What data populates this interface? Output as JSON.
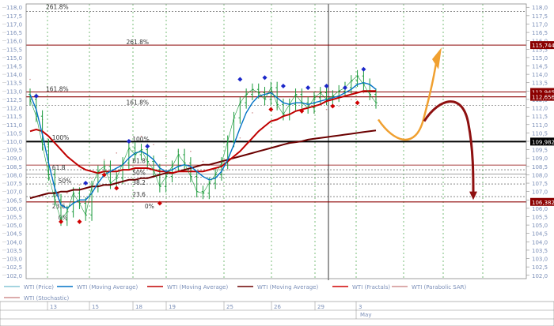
{
  "colors": {
    "price": "#1a9a3a",
    "ma_fast": "#0072c6",
    "ma_mid": "#c00000",
    "ma_slow": "#6b0000",
    "fractal_up": "#1b27c9",
    "fractal_down": "#d00000",
    "sar": "#d09090",
    "level_dark_red": "#8b0000",
    "arrow_orange": "#f0a030",
    "arrow_darkred": "#8e1010",
    "axis_text": "#7b8fb8",
    "grid_dotted": "#40a040"
  },
  "chart_data": {
    "type": "line",
    "title": "",
    "ylim": [
      101.8,
      118.2
    ],
    "y_ticks": [
      102.0,
      102.5,
      103.0,
      103.5,
      104.0,
      104.5,
      105.0,
      105.5,
      106.0,
      106.5,
      107.0,
      107.5,
      108.0,
      108.5,
      109.0,
      109.5,
      110.0,
      110.5,
      111.0,
      111.5,
      112.0,
      112.5,
      113.0,
      113.5,
      114.0,
      114.5,
      115.0,
      115.5,
      116.0,
      116.5,
      117.0,
      117.5,
      118.0
    ],
    "y_tick_labels": [
      "102,0",
      "102,5",
      "103,0",
      "103,5",
      "104,0",
      "104,5",
      "105,0",
      "105,5",
      "106,0",
      "106,5",
      "107,0",
      "107,5",
      "108,0",
      "108,5",
      "109,0",
      "109,5",
      "110,0",
      "110,5",
      "111,0",
      "111,5",
      "112,0",
      "112,5",
      "113,0",
      "113,5",
      "114,0",
      "114,5",
      "115,0",
      "115,5",
      "116,0",
      "116,5",
      "117,0",
      "117,5",
      "118,0"
    ],
    "x_labels": [
      "13",
      "15",
      "18",
      "19",
      "25",
      "26",
      "29",
      "3"
    ],
    "x_sub_label": "May",
    "price_close": [
      112.5,
      111.5,
      109.8,
      108.0,
      106.5,
      105.3,
      105.8,
      106.9,
      106.3,
      105.6,
      107.3,
      108.2,
      108.5,
      107.5,
      107.8,
      108.7,
      109.6,
      109.2,
      109.5,
      108.8,
      108.3,
      107.3,
      107.9,
      108.5,
      109.2,
      108.7,
      107.9,
      107.0,
      106.9,
      107.5,
      108.0,
      108.7,
      110.0,
      111.4,
      112.3,
      112.8,
      113.1,
      112.9,
      112.5,
      113.2,
      112.2,
      111.6,
      112.2,
      112.8,
      112.3,
      112.0,
      112.6,
      112.9,
      112.5,
      112.7,
      113.0,
      113.2,
      113.6,
      113.9,
      113.4,
      112.8,
      112.3
    ],
    "fractals_up": [
      {
        "x": 1,
        "y": 112.7
      },
      {
        "x": 9,
        "y": 107.5
      },
      {
        "x": 16,
        "y": 110.0
      },
      {
        "x": 19,
        "y": 109.7
      },
      {
        "x": 34,
        "y": 113.7
      },
      {
        "x": 38,
        "y": 113.8
      },
      {
        "x": 41,
        "y": 113.3
      },
      {
        "x": 45,
        "y": 113.2
      },
      {
        "x": 48,
        "y": 113.3
      },
      {
        "x": 51,
        "y": 113.2
      },
      {
        "x": 54,
        "y": 114.3
      }
    ],
    "fractals_down": [
      {
        "x": 5,
        "y": 105.2
      },
      {
        "x": 8,
        "y": 105.2
      },
      {
        "x": 12,
        "y": 108.0
      },
      {
        "x": 14,
        "y": 107.2
      },
      {
        "x": 21,
        "y": 106.3
      },
      {
        "x": 39,
        "y": 111.9
      },
      {
        "x": 44,
        "y": 111.8
      },
      {
        "x": 49,
        "y": 112.1
      },
      {
        "x": 53,
        "y": 112.3
      }
    ],
    "ma_fast": [
      112.8,
      111.9,
      110.4,
      108.7,
      107.2,
      106.2,
      106.0,
      106.3,
      106.5,
      106.5,
      106.9,
      107.5,
      108.0,
      108.2,
      108.4,
      108.6,
      109.0,
      109.3,
      109.4,
      109.2,
      108.9,
      108.4,
      108.2,
      108.3,
      108.5,
      108.6,
      108.5,
      108.2,
      107.9,
      107.7,
      107.8,
      108.2,
      108.9,
      109.8,
      110.8,
      111.7,
      112.3,
      112.7,
      112.8,
      112.9,
      112.6,
      112.3,
      112.2,
      112.3,
      112.3,
      112.2,
      112.3,
      112.4,
      112.5,
      112.6,
      112.7,
      112.9,
      113.1,
      113.4,
      113.5,
      113.4,
      113.1
    ],
    "ma_mid": [
      110.6,
      110.7,
      110.6,
      110.3,
      109.9,
      109.5,
      109.1,
      108.8,
      108.5,
      108.3,
      108.2,
      108.1,
      108.2,
      108.2,
      108.2,
      108.3,
      108.3,
      108.4,
      108.4,
      108.4,
      108.3,
      108.2,
      108.2,
      108.1,
      108.2,
      108.2,
      108.2,
      108.2,
      108.2,
      108.3,
      108.4,
      108.5,
      108.8,
      109.1,
      109.4,
      109.8,
      110.2,
      110.6,
      110.9,
      111.2,
      111.3,
      111.5,
      111.6,
      111.8,
      111.9,
      112.0,
      112.1,
      112.2,
      112.4,
      112.5,
      112.6,
      112.7,
      112.8,
      112.9,
      113.0,
      113.0,
      113.0
    ],
    "ma_slow": [
      106.6,
      106.7,
      106.8,
      106.9,
      106.9,
      107.0,
      107.0,
      107.1,
      107.1,
      107.2,
      107.3,
      107.3,
      107.4,
      107.4,
      107.5,
      107.6,
      107.7,
      107.7,
      107.8,
      107.8,
      107.9,
      108.0,
      108.1,
      108.1,
      108.2,
      108.3,
      108.4,
      108.5,
      108.6,
      108.6,
      108.7,
      108.8,
      108.9,
      109.0,
      109.1,
      109.2,
      109.3,
      109.4,
      109.5,
      109.6,
      109.7,
      109.8,
      109.9,
      109.95,
      110.0,
      110.1,
      110.15,
      110.2,
      110.25,
      110.3,
      110.35,
      110.4,
      110.45,
      110.5,
      110.55,
      110.6,
      110.65
    ],
    "levels": [
      {
        "y": 115.744,
        "label": "115,744",
        "color": "#8b0000"
      },
      {
        "y": 112.945,
        "label": "112,945",
        "color": "#8b0000"
      },
      {
        "y": 112.656,
        "label": "112,656",
        "color": "#8b0000"
      },
      {
        "y": 109.982,
        "label": "109,982",
        "color": "#000000"
      },
      {
        "y": 106.382,
        "label": "106,382",
        "color": "#8b0000"
      }
    ],
    "fib_labels": [
      {
        "x": 0,
        "y": 117.9,
        "text": "261.8%"
      },
      {
        "x": 13,
        "y": 115.8,
        "text": "261.8%"
      },
      {
        "x": 0,
        "y": 113.0,
        "text": "161.8%"
      },
      {
        "x": 13,
        "y": 112.2,
        "text": "161.8%"
      },
      {
        "x": 1,
        "y": 110.1,
        "text": "100%"
      },
      {
        "x": 14,
        "y": 110.0,
        "text": "100%"
      },
      {
        "x": 1,
        "y": 108.3,
        "text": "61.8"
      },
      {
        "x": 14,
        "y": 108.7,
        "text": "61.8"
      },
      {
        "x": 2,
        "y": 107.5,
        "text": "50%"
      },
      {
        "x": 14,
        "y": 108.0,
        "text": "50%"
      },
      {
        "x": 1,
        "y": 106.7,
        "text": "38"
      },
      {
        "x": 14,
        "y": 107.4,
        "text": "38.2"
      },
      {
        "x": 1,
        "y": 106.0,
        "text": "23.6"
      },
      {
        "x": 14,
        "y": 106.7,
        "text": "23.6"
      },
      {
        "x": 2,
        "y": 105.3,
        "text": "0%"
      },
      {
        "x": 16,
        "y": 106.0,
        "text": "0%"
      }
    ]
  },
  "legend": {
    "items": [
      {
        "label": "WTI (Price)",
        "color": "#86c6d6"
      },
      {
        "label": "WTI (Moving Average)",
        "color": "#0072c6"
      },
      {
        "label": "WTI (Moving Average)",
        "color": "#c00000"
      },
      {
        "label": "WTI (Moving Average)",
        "color": "#6b0000"
      },
      {
        "label": "WTI (Fractals)",
        "color": "#d00000"
      },
      {
        "label": "WTI (Parabolic SAR)",
        "color": "#d09090"
      },
      {
        "label": "WTI (Stochastic)",
        "color": "#d09090"
      }
    ]
  }
}
